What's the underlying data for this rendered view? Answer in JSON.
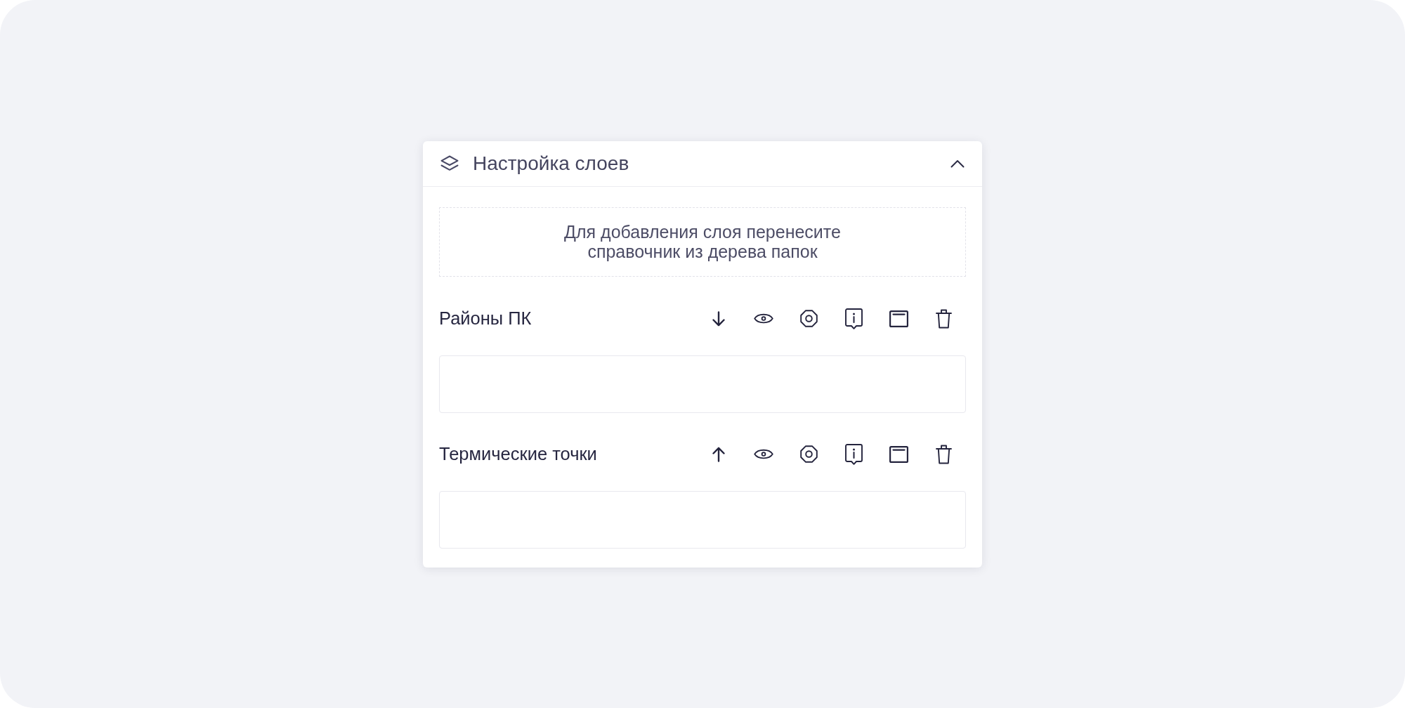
{
  "panel": {
    "title": "Настройка слоев",
    "expanded": true,
    "dropzone": {
      "text": "Для добавления слоя перенесите\nсправочник из дерева папок"
    },
    "layers": [
      {
        "name": "Районы ПК",
        "kind": "down"
      },
      {
        "name": "Термические точки",
        "kind": "up"
      }
    ]
  }
}
